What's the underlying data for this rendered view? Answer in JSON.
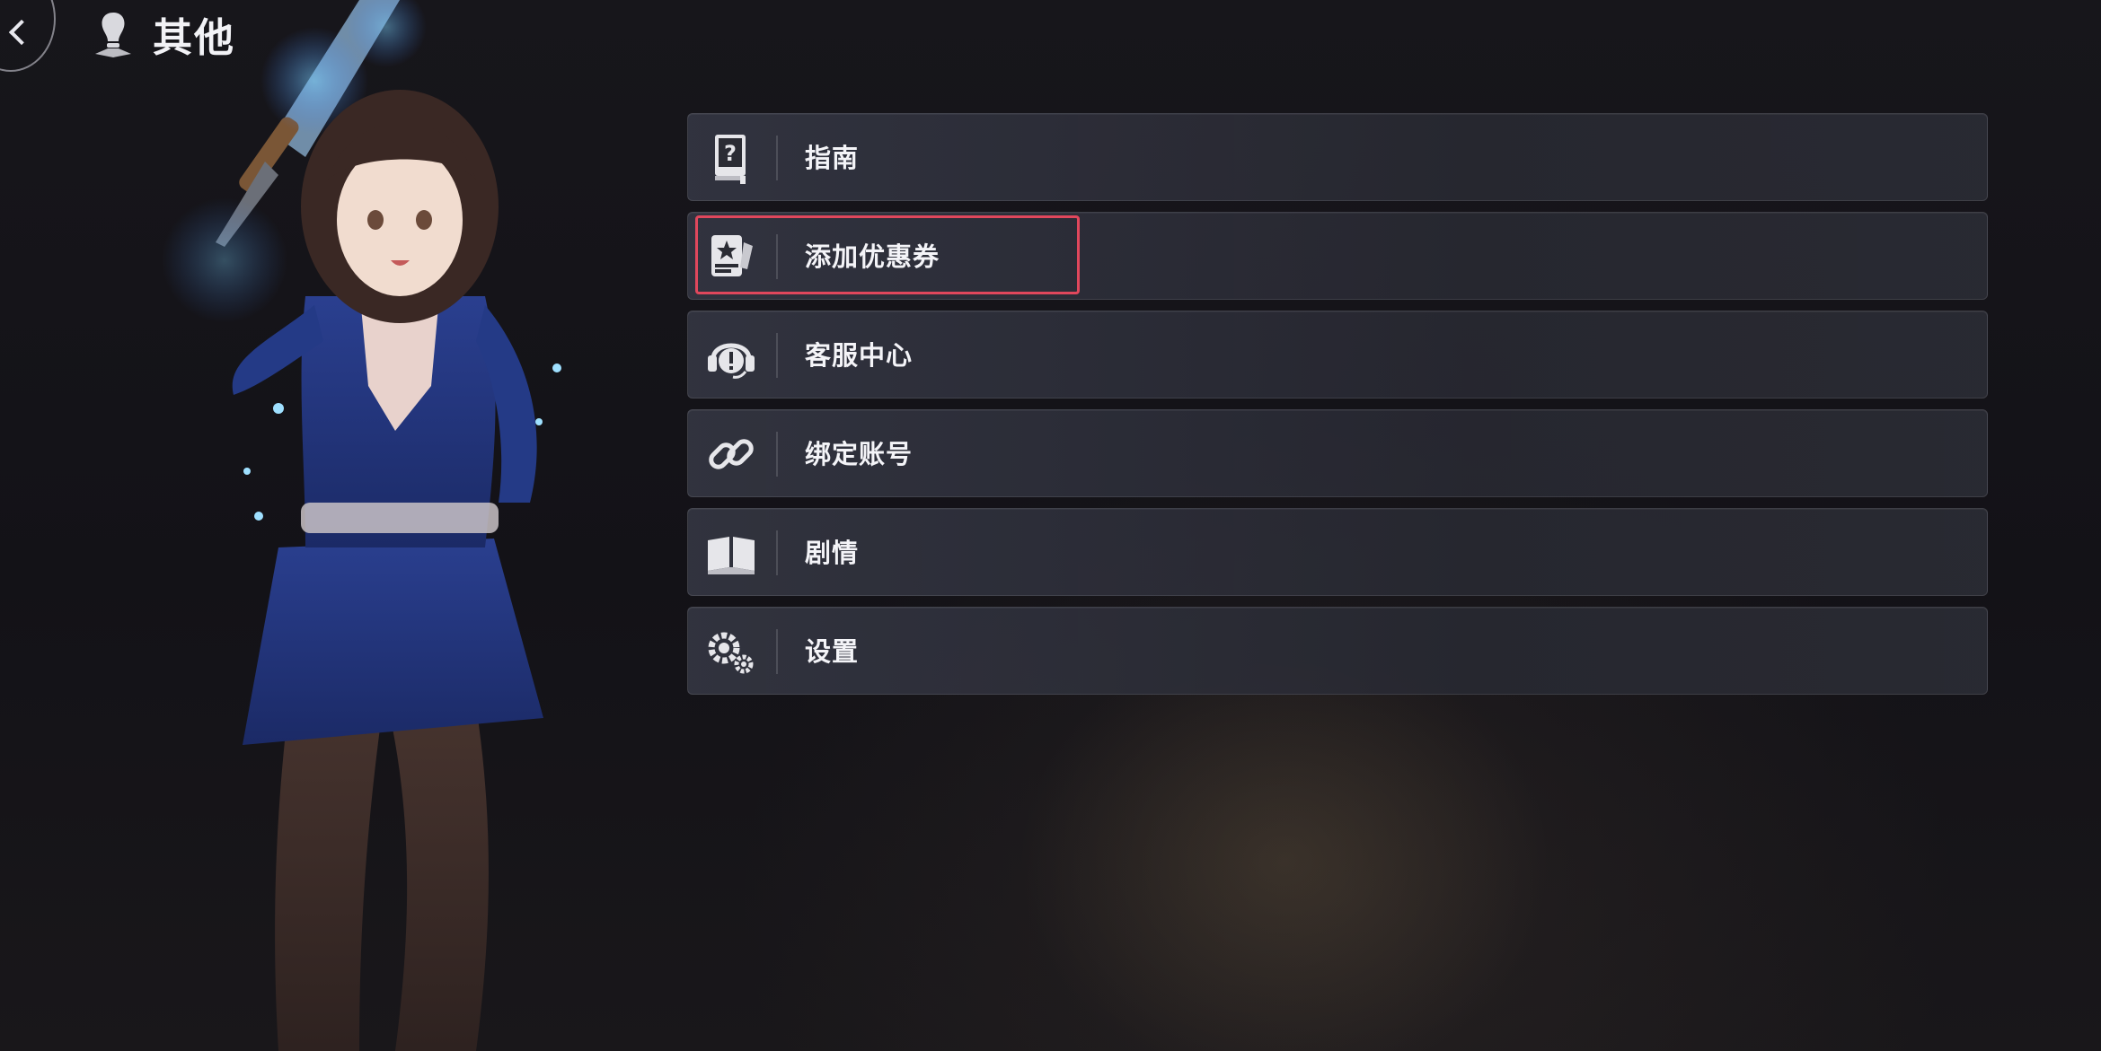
{
  "header": {
    "title": "其他",
    "back_icon": "chevron-left-icon",
    "title_icon": "lightbulb-icon"
  },
  "menu": {
    "items": [
      {
        "label": "指南",
        "icon": "guide-book-icon"
      },
      {
        "label": "添加优惠券",
        "icon": "coupon-icon",
        "highlighted": true
      },
      {
        "label": "客服中心",
        "icon": "headset-icon"
      },
      {
        "label": "绑定账号",
        "icon": "link-icon"
      },
      {
        "label": "剧情",
        "icon": "open-book-icon"
      },
      {
        "label": "设置",
        "icon": "gears-icon"
      }
    ]
  },
  "colors": {
    "highlight_border": "#e0475c",
    "text": "#f4f4f8",
    "background": "#141317"
  }
}
